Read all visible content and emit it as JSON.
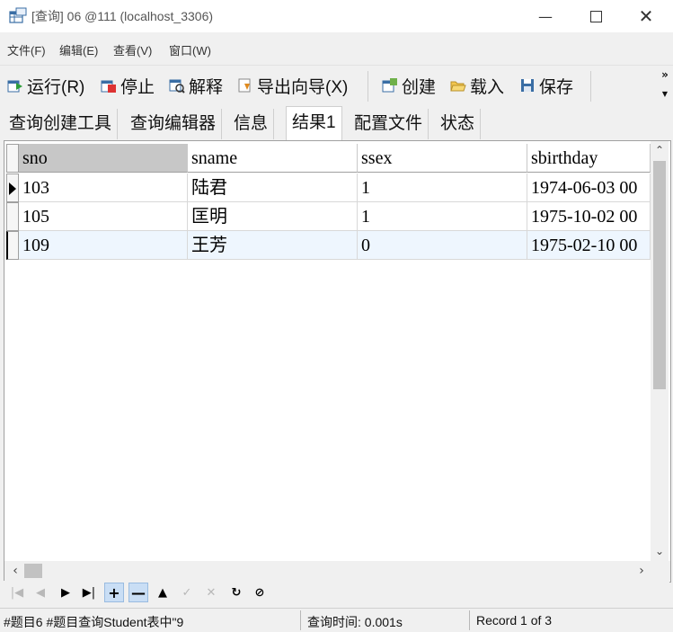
{
  "window": {
    "title": "[查询] 06 @111 (localhost_3306)"
  },
  "menu": [
    {
      "label": "文件(F)"
    },
    {
      "label": "编辑(E)"
    },
    {
      "label": "查看(V)"
    },
    {
      "label": "窗口(W)"
    }
  ],
  "toolbar": {
    "run": "运行(R)",
    "stop": "停止",
    "explain": "解释",
    "export": "导出向导(X)",
    "create": "创建",
    "load": "载入",
    "save": "保存"
  },
  "tabs": [
    {
      "label": "查询创建工具"
    },
    {
      "label": "查询编辑器"
    },
    {
      "label": "信息"
    },
    {
      "label": "结果1"
    },
    {
      "label": "配置文件"
    },
    {
      "label": "状态"
    }
  ],
  "grid": {
    "columns": [
      "sno",
      "sname",
      "ssex",
      "sbirthday"
    ],
    "rows": [
      [
        "103",
        "陆君",
        "1",
        "1974-06-03 00"
      ],
      [
        "105",
        "匡明",
        "1",
        "1975-10-02 00"
      ],
      [
        "109",
        "王芳",
        "0",
        "1975-02-10 00"
      ]
    ]
  },
  "status": {
    "left": "#题目6 #题目查询Student表中\"9",
    "query_time": "查询时间: 0.001s",
    "record": "Record 1 of 3"
  }
}
